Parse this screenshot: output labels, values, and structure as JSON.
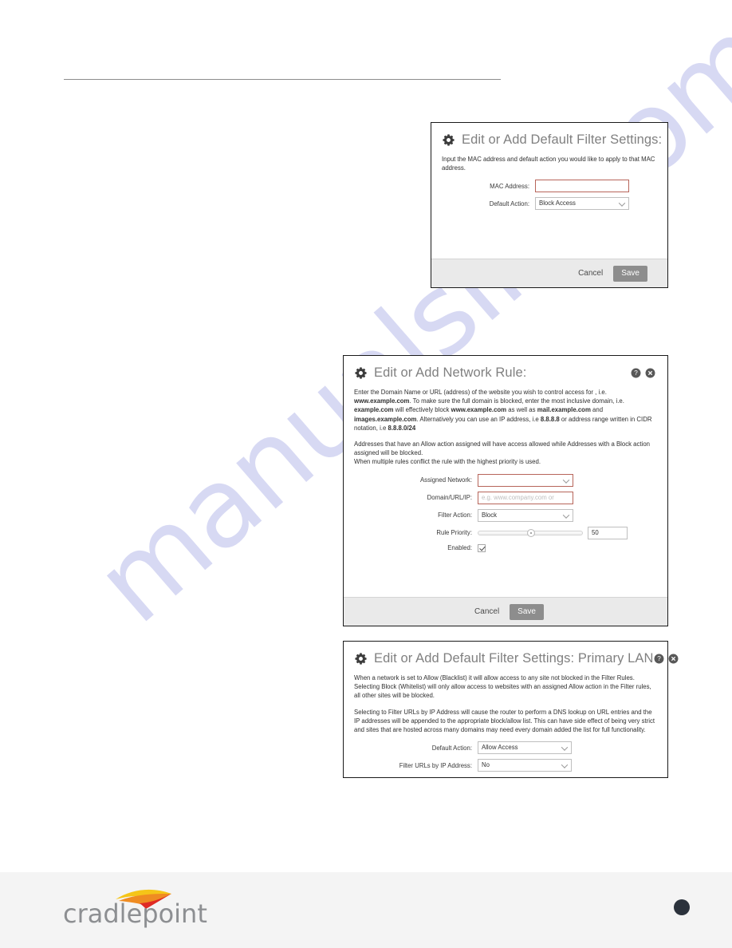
{
  "page": {
    "footer_logo_text": "cradlepoint",
    "watermark": "manualslib.com"
  },
  "dialog_mac": {
    "title": "Edit or Add Default Filter Settings:",
    "gear_icon": "gear-icon",
    "description": "Input the MAC address and default action you would like to apply to that MAC address.",
    "fields": [
      {
        "label": "MAC Address:",
        "type": "text",
        "value": "",
        "placeholder": ""
      },
      {
        "label": "Default Action:",
        "type": "select",
        "value": "Block Access"
      }
    ],
    "buttons": {
      "cancel": "Cancel",
      "save": "Save"
    }
  },
  "dialog_rule": {
    "title": "Edit or Add Network Rule:",
    "gear_icon": "gear-icon",
    "help_icon": "help-icon",
    "close_icon": "close-icon",
    "para1_html": "Enter the Domain Name or URL (address) of the website you wish to control access for , i.e. <b>www.example.com</b>. To make sure the full domain is blocked, enter the most inclusive domain, i.e. <b>example.com</b> will effectively block <b>www.example.com</b> as well as <b>mail.example.com</b> and <b>images.example.com</b>. Alternatively you can use an IP address, i.e <b>8.8.8.8</b> or address range written in CIDR notation, i.e <b>8.8.8.0/24</b>",
    "para2_line1": "Addresses that have an Allow action assigned will have access allowed while Addresses with a Block action assigned will be blocked.",
    "para2_line2": "When multiple rules conflict the rule with the highest priority is used.",
    "fields": [
      {
        "label": "Assigned Network:",
        "type": "select",
        "value": ""
      },
      {
        "label": "Domain/URL/IP:",
        "type": "text",
        "value": "",
        "placeholder": "e.g. www.company.com or"
      },
      {
        "label": "Filter Action:",
        "type": "select",
        "value": "Block"
      },
      {
        "label": "Rule Priority:",
        "type": "slider",
        "value": "50"
      },
      {
        "label": "Enabled:",
        "type": "checkbox",
        "value": "checked"
      }
    ],
    "buttons": {
      "cancel": "Cancel",
      "save": "Save"
    }
  },
  "dialog_lan": {
    "title": "Edit or Add Default Filter Settings: Primary LAN",
    "gear_icon": "gear-icon",
    "help_icon": "help-icon",
    "close_icon": "close-icon",
    "para1": "When a network is set to Allow (Blacklist) it will allow access to any site not blocked in the Filter Rules. Selecting Block (Whitelist) will only allow access to websites with an assigned Allow action in the Filter rules, all other sites will be blocked.",
    "para2": "Selecting to Filter URLs by IP Address will cause the router to perform a DNS lookup on URL entries and the IP addresses will be appended to the appropriate block/allow list. This can have side effect of being very strict and sites that are hosted across many domains may need every domain added the list for full functionality.",
    "fields": [
      {
        "label": "Default Action:",
        "type": "select",
        "value": "Allow Access"
      },
      {
        "label": "Filter URLs by IP Address:",
        "type": "select",
        "value": "No"
      }
    ]
  }
}
